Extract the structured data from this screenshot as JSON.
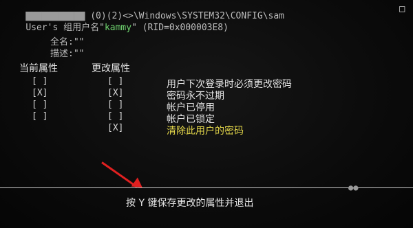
{
  "header": {
    "line1": "(0)(2)<>\\Windows\\SYSTEM32\\CONFIG\\sam",
    "line2_prefix": "User's 组用户名\"",
    "username": "kammy",
    "line2_suffix": "\" (RID=0x000003E8)"
  },
  "close_label": "□",
  "fields": {
    "fullname": "全名:\"\"",
    "comment": "描述:\"\""
  },
  "columns": {
    "current": "当前属性",
    "change": "更改属性"
  },
  "rows": [
    {
      "current": "[ ]",
      "change": "[ ]",
      "label": "用户下次登录时必须更改密码",
      "color": "#e6e6e6"
    },
    {
      "current": "[X]",
      "change": "[X]",
      "label": "密码永不过期",
      "color": "#e6e6e6"
    },
    {
      "current": "[ ]",
      "change": "[ ]",
      "label": "帐户已停用",
      "color": "#e6e6e6"
    },
    {
      "current": "[ ]",
      "change": "[ ]",
      "label": "帐户已锁定",
      "color": "#e6e6e6"
    },
    {
      "current": "",
      "change": "[X]",
      "label": "清除此用户的密码",
      "color": "#e3d64a"
    }
  ],
  "footer": {
    "prompt": "按 Y 键保存更改的属性并退出"
  }
}
